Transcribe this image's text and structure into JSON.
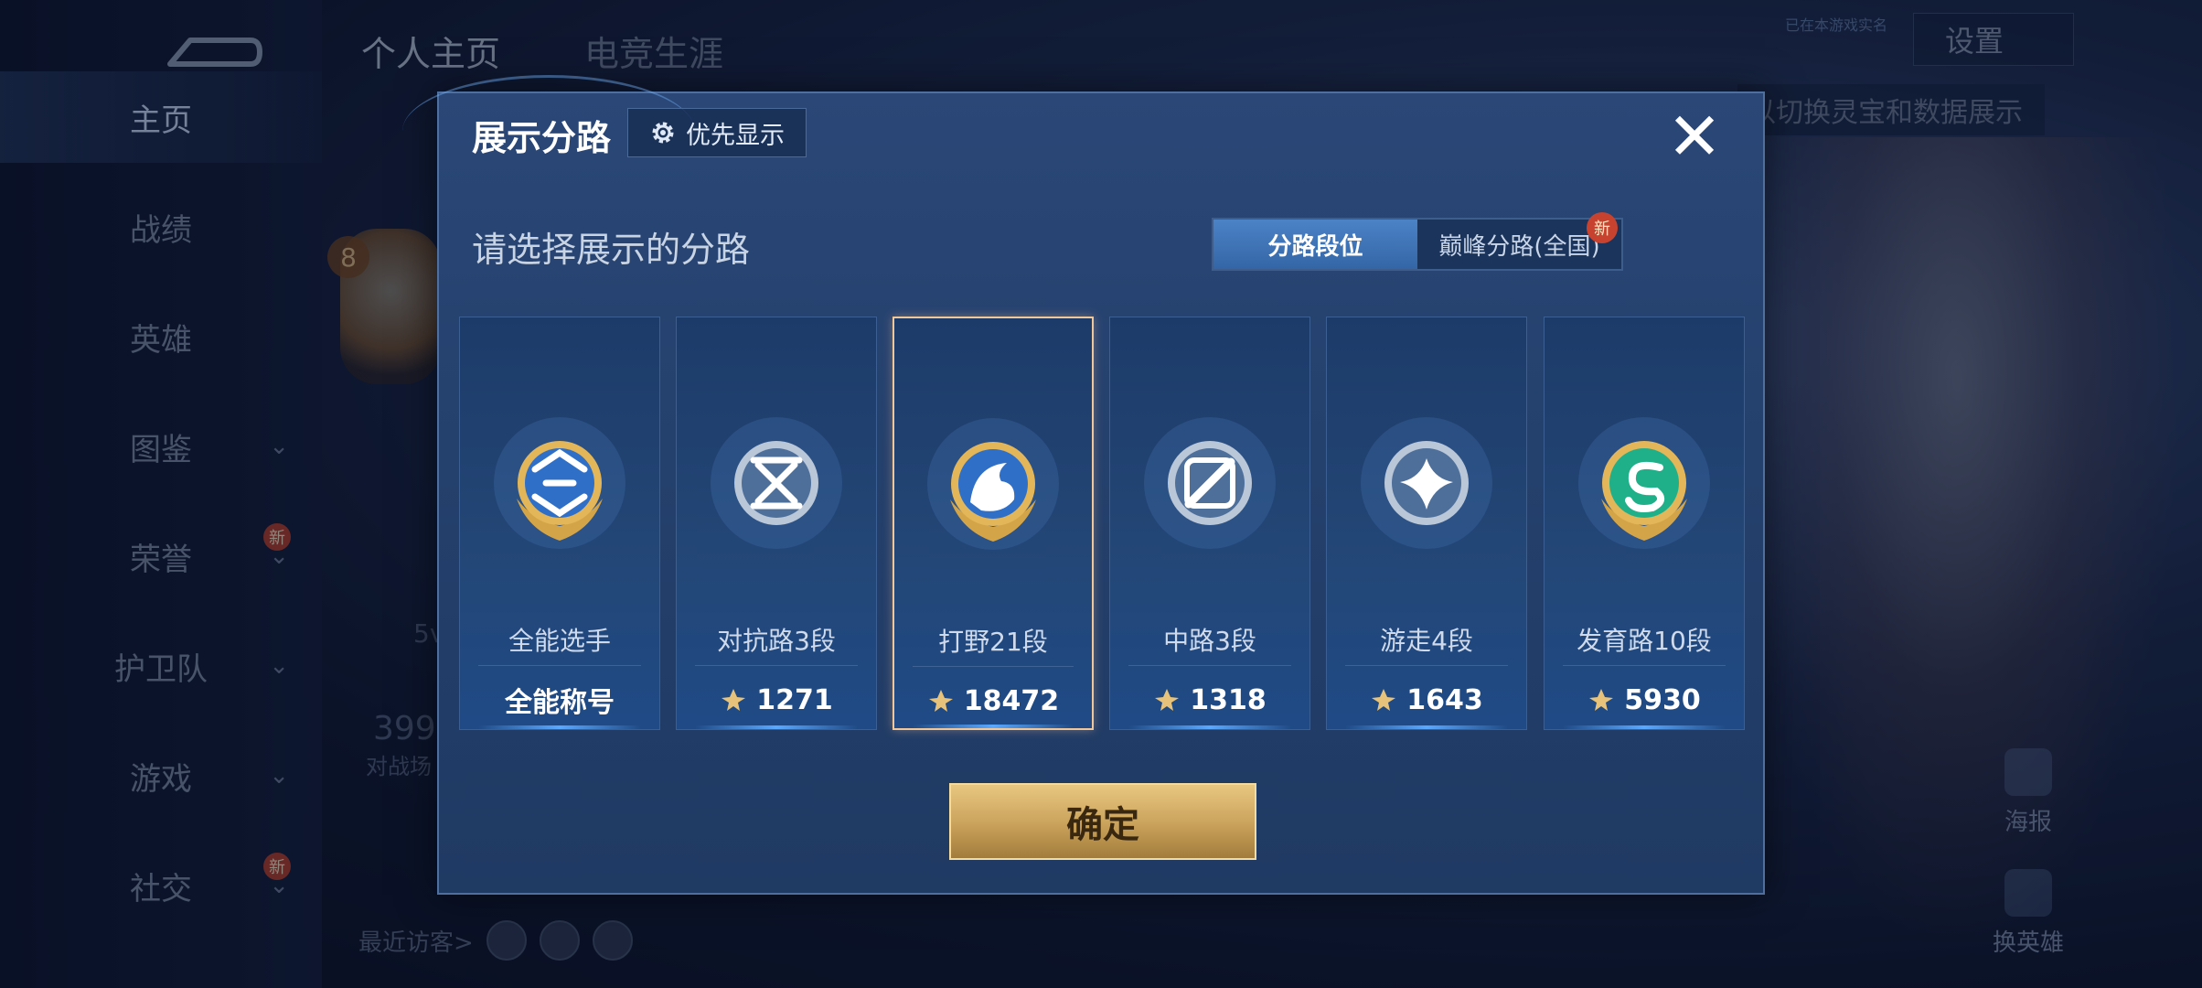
{
  "sidebar": {
    "items": [
      {
        "label": "主页",
        "active": true,
        "chevron": false,
        "new": false
      },
      {
        "label": "战绩",
        "active": false,
        "chevron": false,
        "new": false
      },
      {
        "label": "英雄",
        "active": false,
        "chevron": false,
        "new": false
      },
      {
        "label": "图鉴",
        "active": false,
        "chevron": true,
        "new": false
      },
      {
        "label": "荣誉",
        "active": false,
        "chevron": true,
        "new": true
      },
      {
        "label": "护卫队",
        "active": false,
        "chevron": true,
        "new": false
      },
      {
        "label": "游戏",
        "active": false,
        "chevron": true,
        "new": false
      },
      {
        "label": "社交",
        "active": false,
        "chevron": true,
        "new": true
      }
    ],
    "new_label": "新"
  },
  "top_tabs": [
    "个人主页",
    "电竞生涯"
  ],
  "settings_label": "设置",
  "top_hint": "已在本游戏实名",
  "hint_bar": "以切换灵宝和数据展示",
  "level_badge": "8",
  "bg_stats": {
    "count": "399",
    "label": "对战场",
    "mode": "5v"
  },
  "recent_visitors_label": "最近访客>",
  "right_buttons": {
    "poster": "海报",
    "change_hero": "换英雄"
  },
  "modal": {
    "title": "展示分路",
    "priority_label": "优先显示",
    "close_symbol": "✕",
    "subtitle": "请选择展示的分路",
    "toggle": {
      "option1": "分路段位",
      "option2": "巅峰分路(全国)",
      "new_badge": "新"
    },
    "confirm_label": "确定",
    "cards": [
      {
        "lane": "全能选手",
        "value": "全能称号",
        "has_icon": false,
        "selected": false,
        "emblem": "allround",
        "ring": "gold"
      },
      {
        "lane": "对抗路3段",
        "value": "1271",
        "has_icon": true,
        "selected": false,
        "emblem": "clash",
        "ring": "silver"
      },
      {
        "lane": "打野21段",
        "value": "18472",
        "has_icon": true,
        "selected": true,
        "emblem": "jungle",
        "ring": "gold"
      },
      {
        "lane": "中路3段",
        "value": "1318",
        "has_icon": true,
        "selected": false,
        "emblem": "mid",
        "ring": "silver"
      },
      {
        "lane": "游走4段",
        "value": "1643",
        "has_icon": true,
        "selected": false,
        "emblem": "roam",
        "ring": "silver"
      },
      {
        "lane": "发育路10段",
        "value": "5930",
        "has_icon": true,
        "selected": false,
        "emblem": "farm",
        "ring": "gold"
      }
    ]
  },
  "colors": {
    "accent": "#3466a6",
    "gold": "#c9a15a",
    "selected_border": "#f0c79a"
  }
}
